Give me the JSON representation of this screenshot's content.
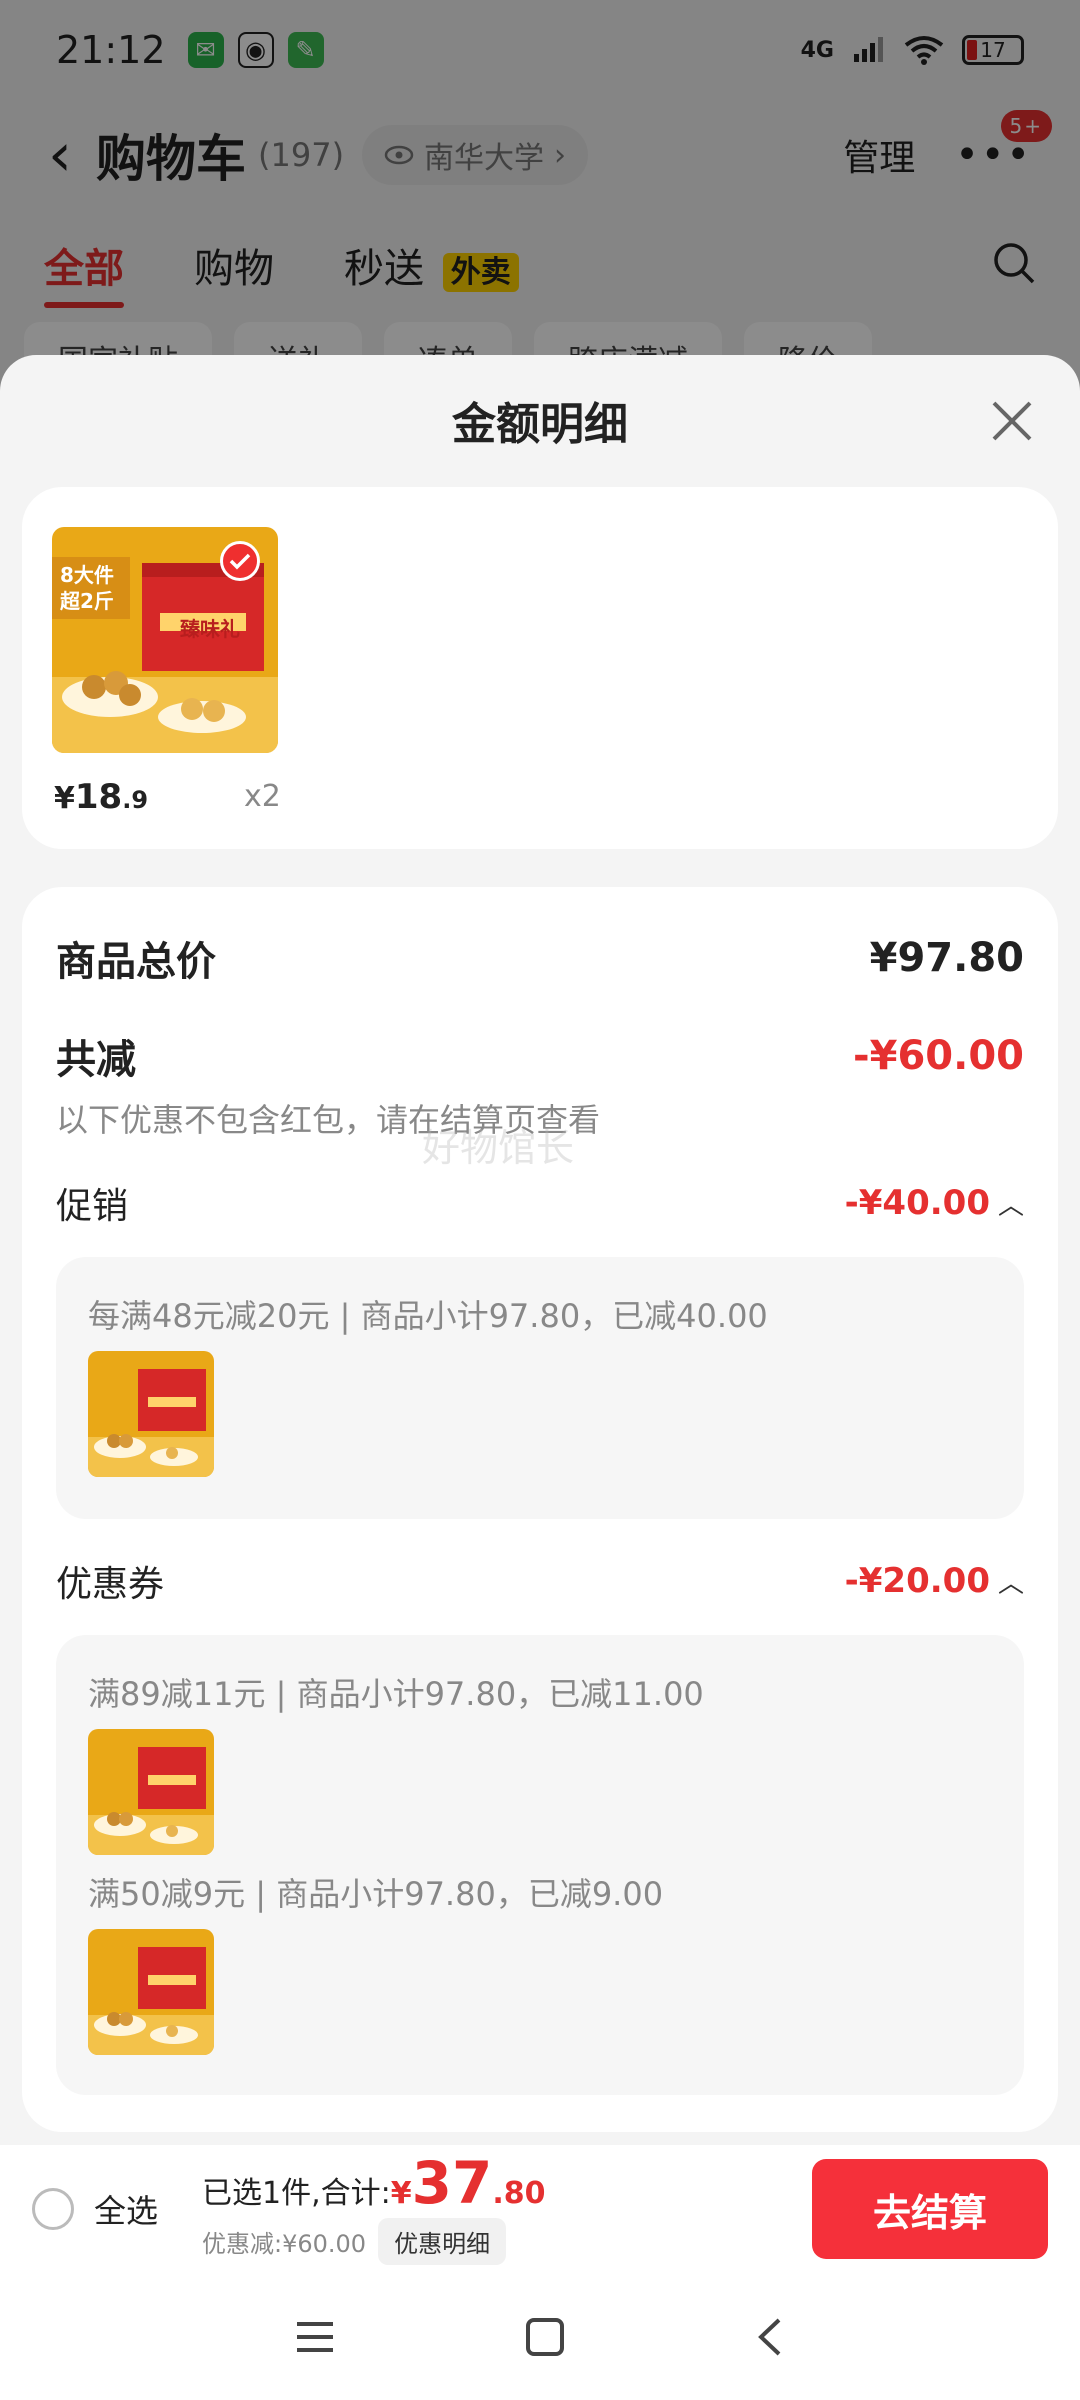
{
  "status_bar": {
    "time": "21:12",
    "network": "4G",
    "battery": "17",
    "apps": [
      "wechat-icon",
      "qq-icon",
      "tool-icon"
    ]
  },
  "header": {
    "title": "购物车",
    "count": "(197)",
    "location": "南华大学",
    "manage": "管理",
    "badge": "5+"
  },
  "tabs": [
    {
      "label": "全部",
      "active": true
    },
    {
      "label": "购物"
    },
    {
      "label": "秒送",
      "badge": "外卖"
    }
  ],
  "chips": [
    "国家补贴",
    "送礼",
    "凑单",
    "跨店满减",
    "降价"
  ],
  "sheet": {
    "title": "金额明细",
    "product": {
      "price_symbol": "¥",
      "price_int": "18",
      "price_frac": ".9",
      "qty": "x2",
      "thumb_line1": "8大件",
      "thumb_line2": "超2斤",
      "box_text": "臻味礼"
    },
    "total_label": "商品总价",
    "total_value": "¥97.80",
    "discount_label": "共减",
    "discount_value": "-¥60.00",
    "note": "以下优惠不包含红包，请在结算页查看",
    "watermark": "好物馆长",
    "promo": {
      "label": "促销",
      "value": "-¥40.00",
      "rule": "每满48元减20元 | 商品小计97.80，已减40.00"
    },
    "coupon": {
      "label": "优惠券",
      "value": "-¥20.00",
      "rules": [
        "满89减11元 | 商品小计97.80，已减11.00",
        "满50减9元 | 商品小计97.80，已减9.00"
      ]
    }
  },
  "bottom_bar": {
    "select_all": "全选",
    "selected_text": "已选1件,合计:",
    "total_symbol": "¥",
    "total_int": "37",
    "total_dec": ".80",
    "saved_text": "优惠减:¥60.00",
    "detail_button": "优惠明细",
    "checkout": "去结算"
  },
  "colors": {
    "accent_red": "#e53030",
    "checkout_red": "#f5303a",
    "badge_yellow": "#ffd200"
  }
}
